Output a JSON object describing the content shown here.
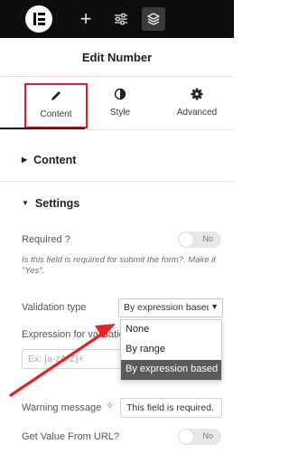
{
  "topbar": {
    "logo_icon": "elementor-logo-icon",
    "add_icon": "plus-icon",
    "settings_icon": "sliders-icon",
    "structure_icon": "layers-icon"
  },
  "panel": {
    "title": "Edit Number"
  },
  "tabs": [
    {
      "label": "Content",
      "icon": "pencil-icon",
      "active": true
    },
    {
      "label": "Style",
      "icon": "contrast-icon",
      "active": false
    },
    {
      "label": "Advanced",
      "icon": "gear-icon",
      "active": false
    }
  ],
  "sections": {
    "content": {
      "title": "Content",
      "expanded": false
    },
    "settings": {
      "title": "Settings",
      "expanded": true
    }
  },
  "fields": {
    "required": {
      "label": "Required ?",
      "toggle_label": "No",
      "hint": "Is this field is required for submit the form?. Make it \"Yes\"."
    },
    "validation_type": {
      "label": "Validation type",
      "value": "By expression based",
      "options": [
        "None",
        "By range",
        "By expression based"
      ],
      "selected_index": 2
    },
    "expression": {
      "label": "Expression for validation",
      "placeholder": "Ex: [a-zA-Z]+"
    },
    "warning_message": {
      "label": "Warning message",
      "value": "This field is required."
    },
    "get_value_from_url": {
      "label": "Get Value From URL?",
      "toggle_label": "No"
    }
  },
  "colors": {
    "topbar_bg": "#0d0d0d",
    "highlight_box": "#e02020",
    "arrow": "#e8202a",
    "dropdown_selected": "#5b5b5b",
    "ai_sparkle": "#a855f7"
  }
}
